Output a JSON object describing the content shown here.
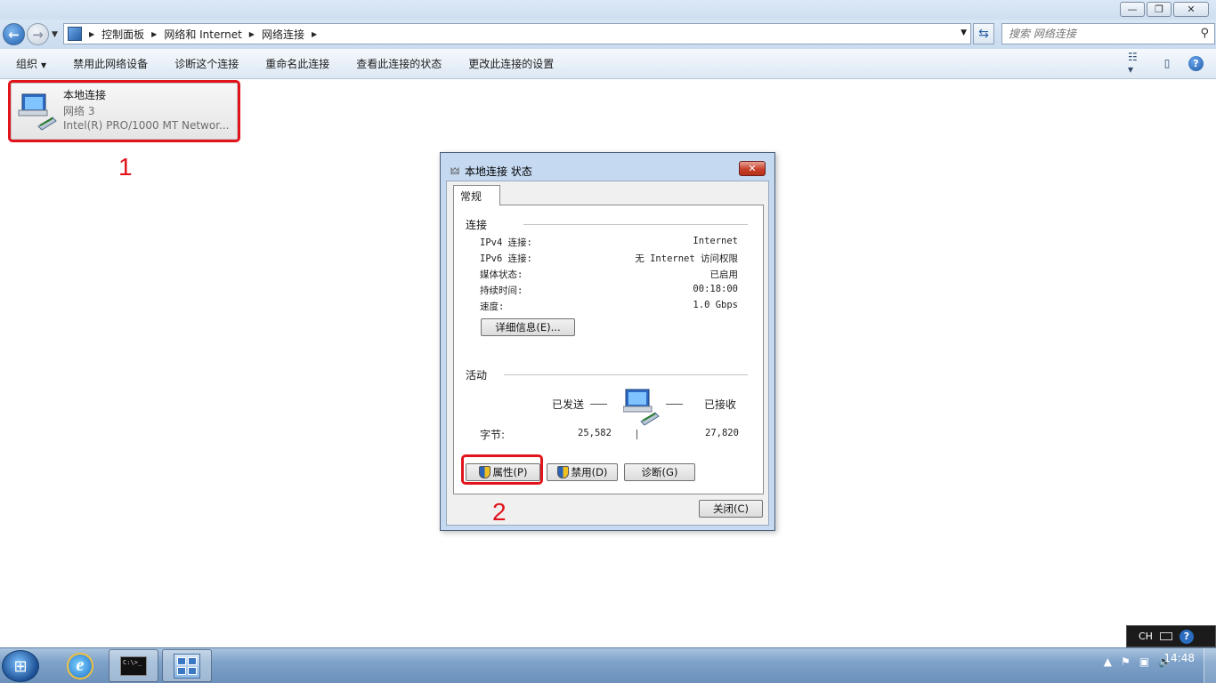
{
  "window": {
    "minimize": "—",
    "restore": "❐",
    "close": "✕"
  },
  "address": {
    "crumbs": [
      "控制面板",
      "网络和 Internet",
      "网络连接"
    ],
    "search_placeholder": "搜索 网络连接"
  },
  "commands": {
    "organize": "组织",
    "disable": "禁用此网络设备",
    "diagnose": "诊断这个连接",
    "rename": "重命名此连接",
    "view_status": "查看此连接的状态",
    "change_settings": "更改此连接的设置"
  },
  "connection": {
    "name": "本地连接",
    "network": "网络  3",
    "adapter": "Intel(R) PRO/1000 MT Networ..."
  },
  "annotations": {
    "one": "1",
    "two": "2"
  },
  "dialog": {
    "title": "本地连接 状态",
    "tab": "常规",
    "group_connection": "连接",
    "rows": [
      {
        "label": "IPv4 连接:",
        "value": "Internet"
      },
      {
        "label": "IPv6 连接:",
        "value": "无 Internet 访问权限"
      },
      {
        "label": "媒体状态:",
        "value": "已启用"
      },
      {
        "label": "持续时间:",
        "value": "00:18:00"
      },
      {
        "label": "速度:",
        "value": "1.0 Gbps"
      }
    ],
    "details_button": "详细信息(E)...",
    "group_activity": "活动",
    "sent_label": "已发送",
    "received_label": "已接收",
    "bytes_label": "字节:",
    "bytes_sent": "25,582",
    "bytes_received": "27,820",
    "properties_button": "属性(P)",
    "disable_button": "禁用(D)",
    "diagnose_button": "诊断(G)",
    "close_button": "关闭(C)"
  },
  "taskbar": {
    "ie_letter": "e",
    "cmd_text": "C:\\>_",
    "time": "14:48",
    "lang": "CH"
  },
  "colors": {
    "annotation_red": "#e1141c",
    "accent_blue": "#1f5fae"
  }
}
